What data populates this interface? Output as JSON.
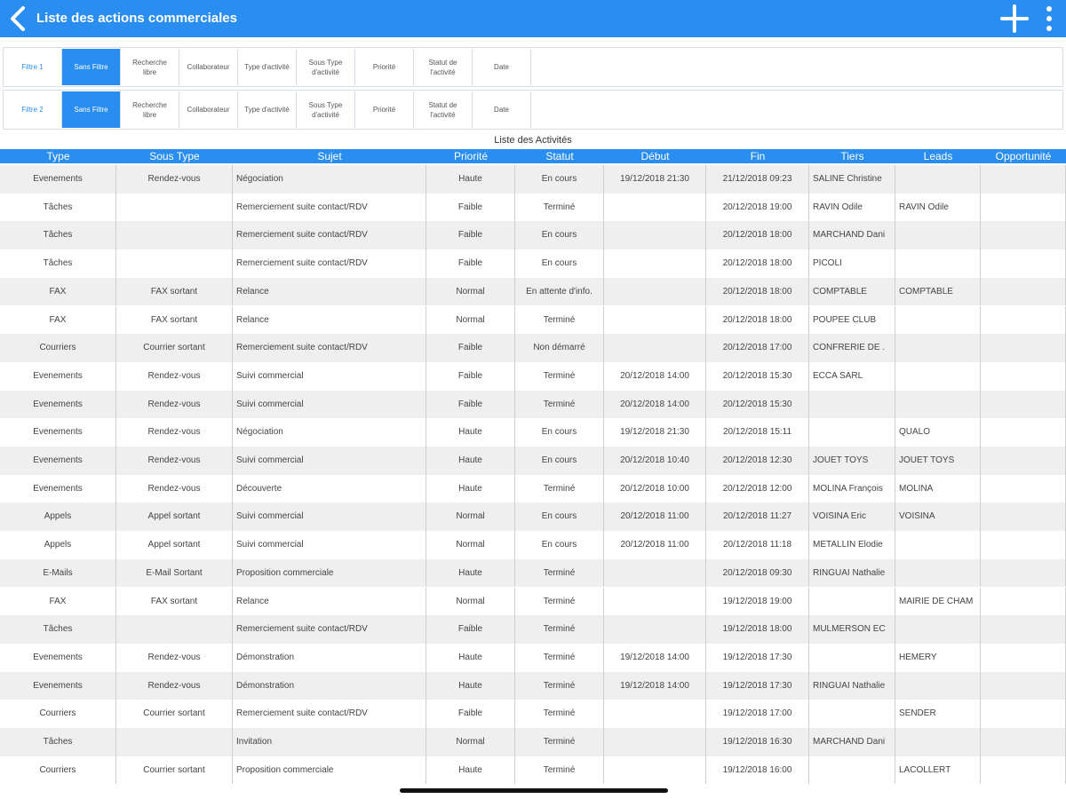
{
  "header": {
    "title": "Liste des actions commerciales",
    "back_icon": "chevron-left-icon",
    "add_icon": "plus-icon",
    "menu_icon": "more-vertical-icon",
    "accent_color": "#2a8df0"
  },
  "filters": [
    {
      "label": "Filtre 1",
      "items": [
        "Sans Filtre",
        "Recherche\nlibre",
        "Collaborateur",
        "Type d'activité",
        "Sous Type\nd'activité",
        "Priorité",
        "Statut de\nl'activité",
        "Date"
      ]
    },
    {
      "label": "Filtre 2",
      "items": [
        "Sans Filtre",
        "Recherche\nlibre",
        "Collaborateur",
        "Type d'activité",
        "Sous Type\nd'activité",
        "Priorité",
        "Statut de\nl'activité",
        "Date"
      ]
    }
  ],
  "list_title": "Liste des Activités",
  "columns": [
    "Type",
    "Sous Type",
    "Sujet",
    "Priorité",
    "Statut",
    "Début",
    "Fin",
    "Tiers",
    "Leads",
    "Opportunité"
  ],
  "rows": [
    [
      "Evenements",
      "Rendez-vous",
      "Négociation",
      "Haute",
      "En cours",
      "19/12/2018 21:30",
      "21/12/2018 09:23",
      "SALINE Christine",
      "",
      ""
    ],
    [
      "Tâches",
      "",
      "Remerciement suite contact/RDV",
      "Faible",
      "Terminé",
      "",
      "20/12/2018 19:00",
      "RAVIN Odile",
      "RAVIN Odile",
      ""
    ],
    [
      "Tâches",
      "",
      "Remerciement suite contact/RDV",
      "Faible",
      "En cours",
      "",
      "20/12/2018 18:00",
      "MARCHAND Dani",
      "",
      ""
    ],
    [
      "Tâches",
      "",
      "Remerciement suite contact/RDV",
      "Faible",
      "En cours",
      "",
      "20/12/2018 18:00",
      "PICOLI",
      "",
      ""
    ],
    [
      "FAX",
      "FAX sortant",
      "Relance",
      "Normal",
      "En attente d'info.",
      "",
      "20/12/2018 18:00",
      "COMPTABLE",
      "COMPTABLE",
      ""
    ],
    [
      "FAX",
      "FAX sortant",
      "Relance",
      "Normal",
      "Terminé",
      "",
      "20/12/2018 18:00",
      "POUPEE CLUB",
      "",
      ""
    ],
    [
      "Courriers",
      "Courrier sortant",
      "Remerciement suite contact/RDV",
      "Faible",
      "Non démarré",
      "",
      "20/12/2018 17:00",
      "CONFRERIE DE .",
      "",
      ""
    ],
    [
      "Evenements",
      "Rendez-vous",
      "Suivi commercial",
      "Faible",
      "Terminé",
      "20/12/2018 14:00",
      "20/12/2018 15:30",
      "ECCA SARL",
      "",
      ""
    ],
    [
      "Evenements",
      "Rendez-vous",
      "Suivi commercial",
      "Faible",
      "Terminé",
      "20/12/2018 14:00",
      "20/12/2018 15:30",
      "",
      "",
      ""
    ],
    [
      "Evenements",
      "Rendez-vous",
      "Négociation",
      "Haute",
      "En cours",
      "19/12/2018 21:30",
      "20/12/2018 15:11",
      "",
      "QUALO",
      ""
    ],
    [
      "Evenements",
      "Rendez-vous",
      "Suivi commercial",
      "Haute",
      "En cours",
      "20/12/2018 10:40",
      "20/12/2018 12:30",
      "JOUET TOYS",
      "JOUET TOYS",
      ""
    ],
    [
      "Evenements",
      "Rendez-vous",
      "Découverte",
      "Haute",
      "Terminé",
      "20/12/2018 10:00",
      "20/12/2018 12:00",
      "MOLINA François",
      "MOLINA",
      ""
    ],
    [
      "Appels",
      "Appel sortant",
      "Suivi commercial",
      "Normal",
      "En cours",
      "20/12/2018 11:00",
      "20/12/2018 11:27",
      "VOISINA Eric",
      "VOISINA",
      ""
    ],
    [
      "Appels",
      "Appel sortant",
      "Suivi commercial",
      "Normal",
      "En cours",
      "20/12/2018 11:00",
      "20/12/2018 11:18",
      "METALLIN Elodie",
      "",
      ""
    ],
    [
      "E-Mails",
      "E-Mail Sortant",
      "Proposition commerciale",
      "Haute",
      "Terminé",
      "",
      "20/12/2018 09:30",
      "RINGUAI Nathalie",
      "",
      ""
    ],
    [
      "FAX",
      "FAX sortant",
      "Relance",
      "Normal",
      "Terminé",
      "",
      "19/12/2018 19:00",
      "",
      "MAIRIE DE CHAM",
      ""
    ],
    [
      "Tâches",
      "",
      "Remerciement suite contact/RDV",
      "Faible",
      "Terminé",
      "",
      "19/12/2018 18:00",
      "MULMERSON EC",
      "",
      ""
    ],
    [
      "Evenements",
      "Rendez-vous",
      "Démonstration",
      "Haute",
      "Terminé",
      "19/12/2018 14:00",
      "19/12/2018 17:30",
      "",
      "HEMERY",
      ""
    ],
    [
      "Evenements",
      "Rendez-vous",
      "Démonstration",
      "Haute",
      "Terminé",
      "19/12/2018 14:00",
      "19/12/2018 17:30",
      "RINGUAI Nathalie",
      "",
      ""
    ],
    [
      "Courriers",
      "Courrier sortant",
      "Remerciement suite contact/RDV",
      "Faible",
      "Terminé",
      "",
      "19/12/2018 17:00",
      "",
      "SENDER",
      ""
    ],
    [
      "Tâches",
      "",
      "Invitation",
      "Normal",
      "Terminé",
      "",
      "19/12/2018 16:30",
      "MARCHAND Dani",
      "",
      ""
    ],
    [
      "Courriers",
      "Courrier sortant",
      "Proposition commerciale",
      "Haute",
      "Terminé",
      "",
      "19/12/2018 16:00",
      "",
      "LACOLLERT",
      ""
    ]
  ]
}
